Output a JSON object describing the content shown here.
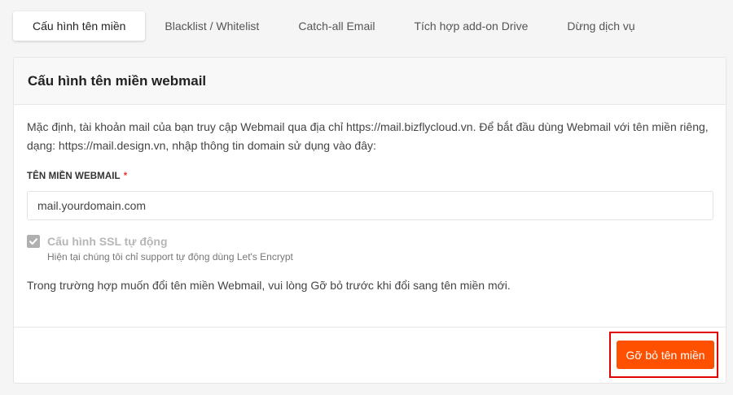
{
  "tabs": [
    {
      "label": "Cấu hình tên miền",
      "active": true
    },
    {
      "label": "Blacklist / Whitelist",
      "active": false
    },
    {
      "label": "Catch-all Email",
      "active": false
    },
    {
      "label": "Tích hợp add-on Drive",
      "active": false
    },
    {
      "label": "Dừng dịch vụ",
      "active": false
    }
  ],
  "card": {
    "title": "Cấu hình tên miền webmail",
    "description_line1": "Mặc định, tài khoản mail của bạn truy cập Webmail qua địa chỉ https://mail.bizflycloud.vn. Để bắt đầu dùng Webmail với tên miền riêng,",
    "description_line2": "dạng: https://mail.design.vn, nhập thông tin domain sử dụng vào đây:",
    "field_label": "TÊN MIỀN WEBMAIL",
    "required_mark": "*",
    "input_value": "mail.yourdomain.com",
    "ssl_label": "Cấu hình SSL tự động",
    "ssl_checked": true,
    "ssl_help": "Hiện tại chúng tôi chỉ support tự động dùng Let's Encrypt",
    "note": "Trong trường hợp muốn đổi tên miền Webmail, vui lòng Gỡ bỏ trước khi đổi sang tên miền mới.",
    "remove_button": "Gỡ bỏ tên miền"
  },
  "colors": {
    "accent": "#ff5000",
    "highlight_frame": "#e30000"
  }
}
